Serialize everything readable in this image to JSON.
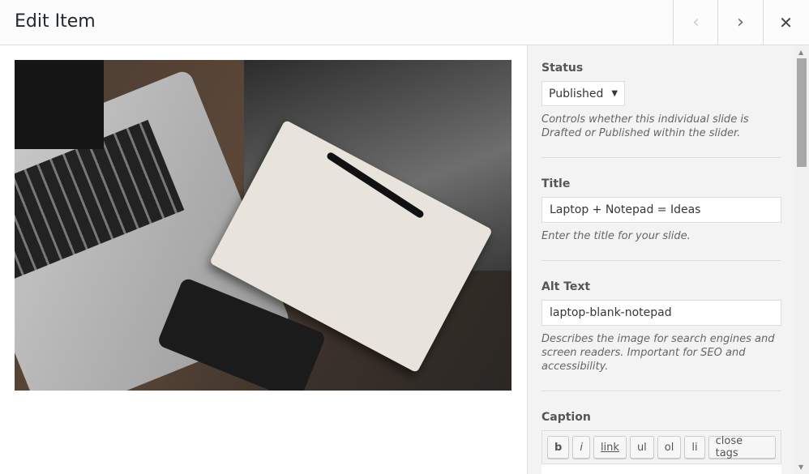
{
  "header": {
    "title": "Edit Item",
    "prev_icon": "chevron-left-icon",
    "next_icon": "chevron-right-icon",
    "close_icon": "close-icon"
  },
  "media": {
    "alt": "laptop-blank-notepad"
  },
  "fields": {
    "status": {
      "label": "Status",
      "value": "Published",
      "description": "Controls whether this individual slide is Drafted or Published within the slider."
    },
    "title": {
      "label": "Title",
      "value": "Laptop + Notepad = Ideas",
      "description": "Enter the title for your slide."
    },
    "alt": {
      "label": "Alt Text",
      "value": "laptop-blank-notepad",
      "description": "Describes the image for search engines and screen readers. Important for SEO and accessibility."
    },
    "caption": {
      "label": "Caption",
      "toolbar": [
        "b",
        "i",
        "link",
        "ul",
        "ol",
        "li",
        "close tags"
      ]
    }
  }
}
